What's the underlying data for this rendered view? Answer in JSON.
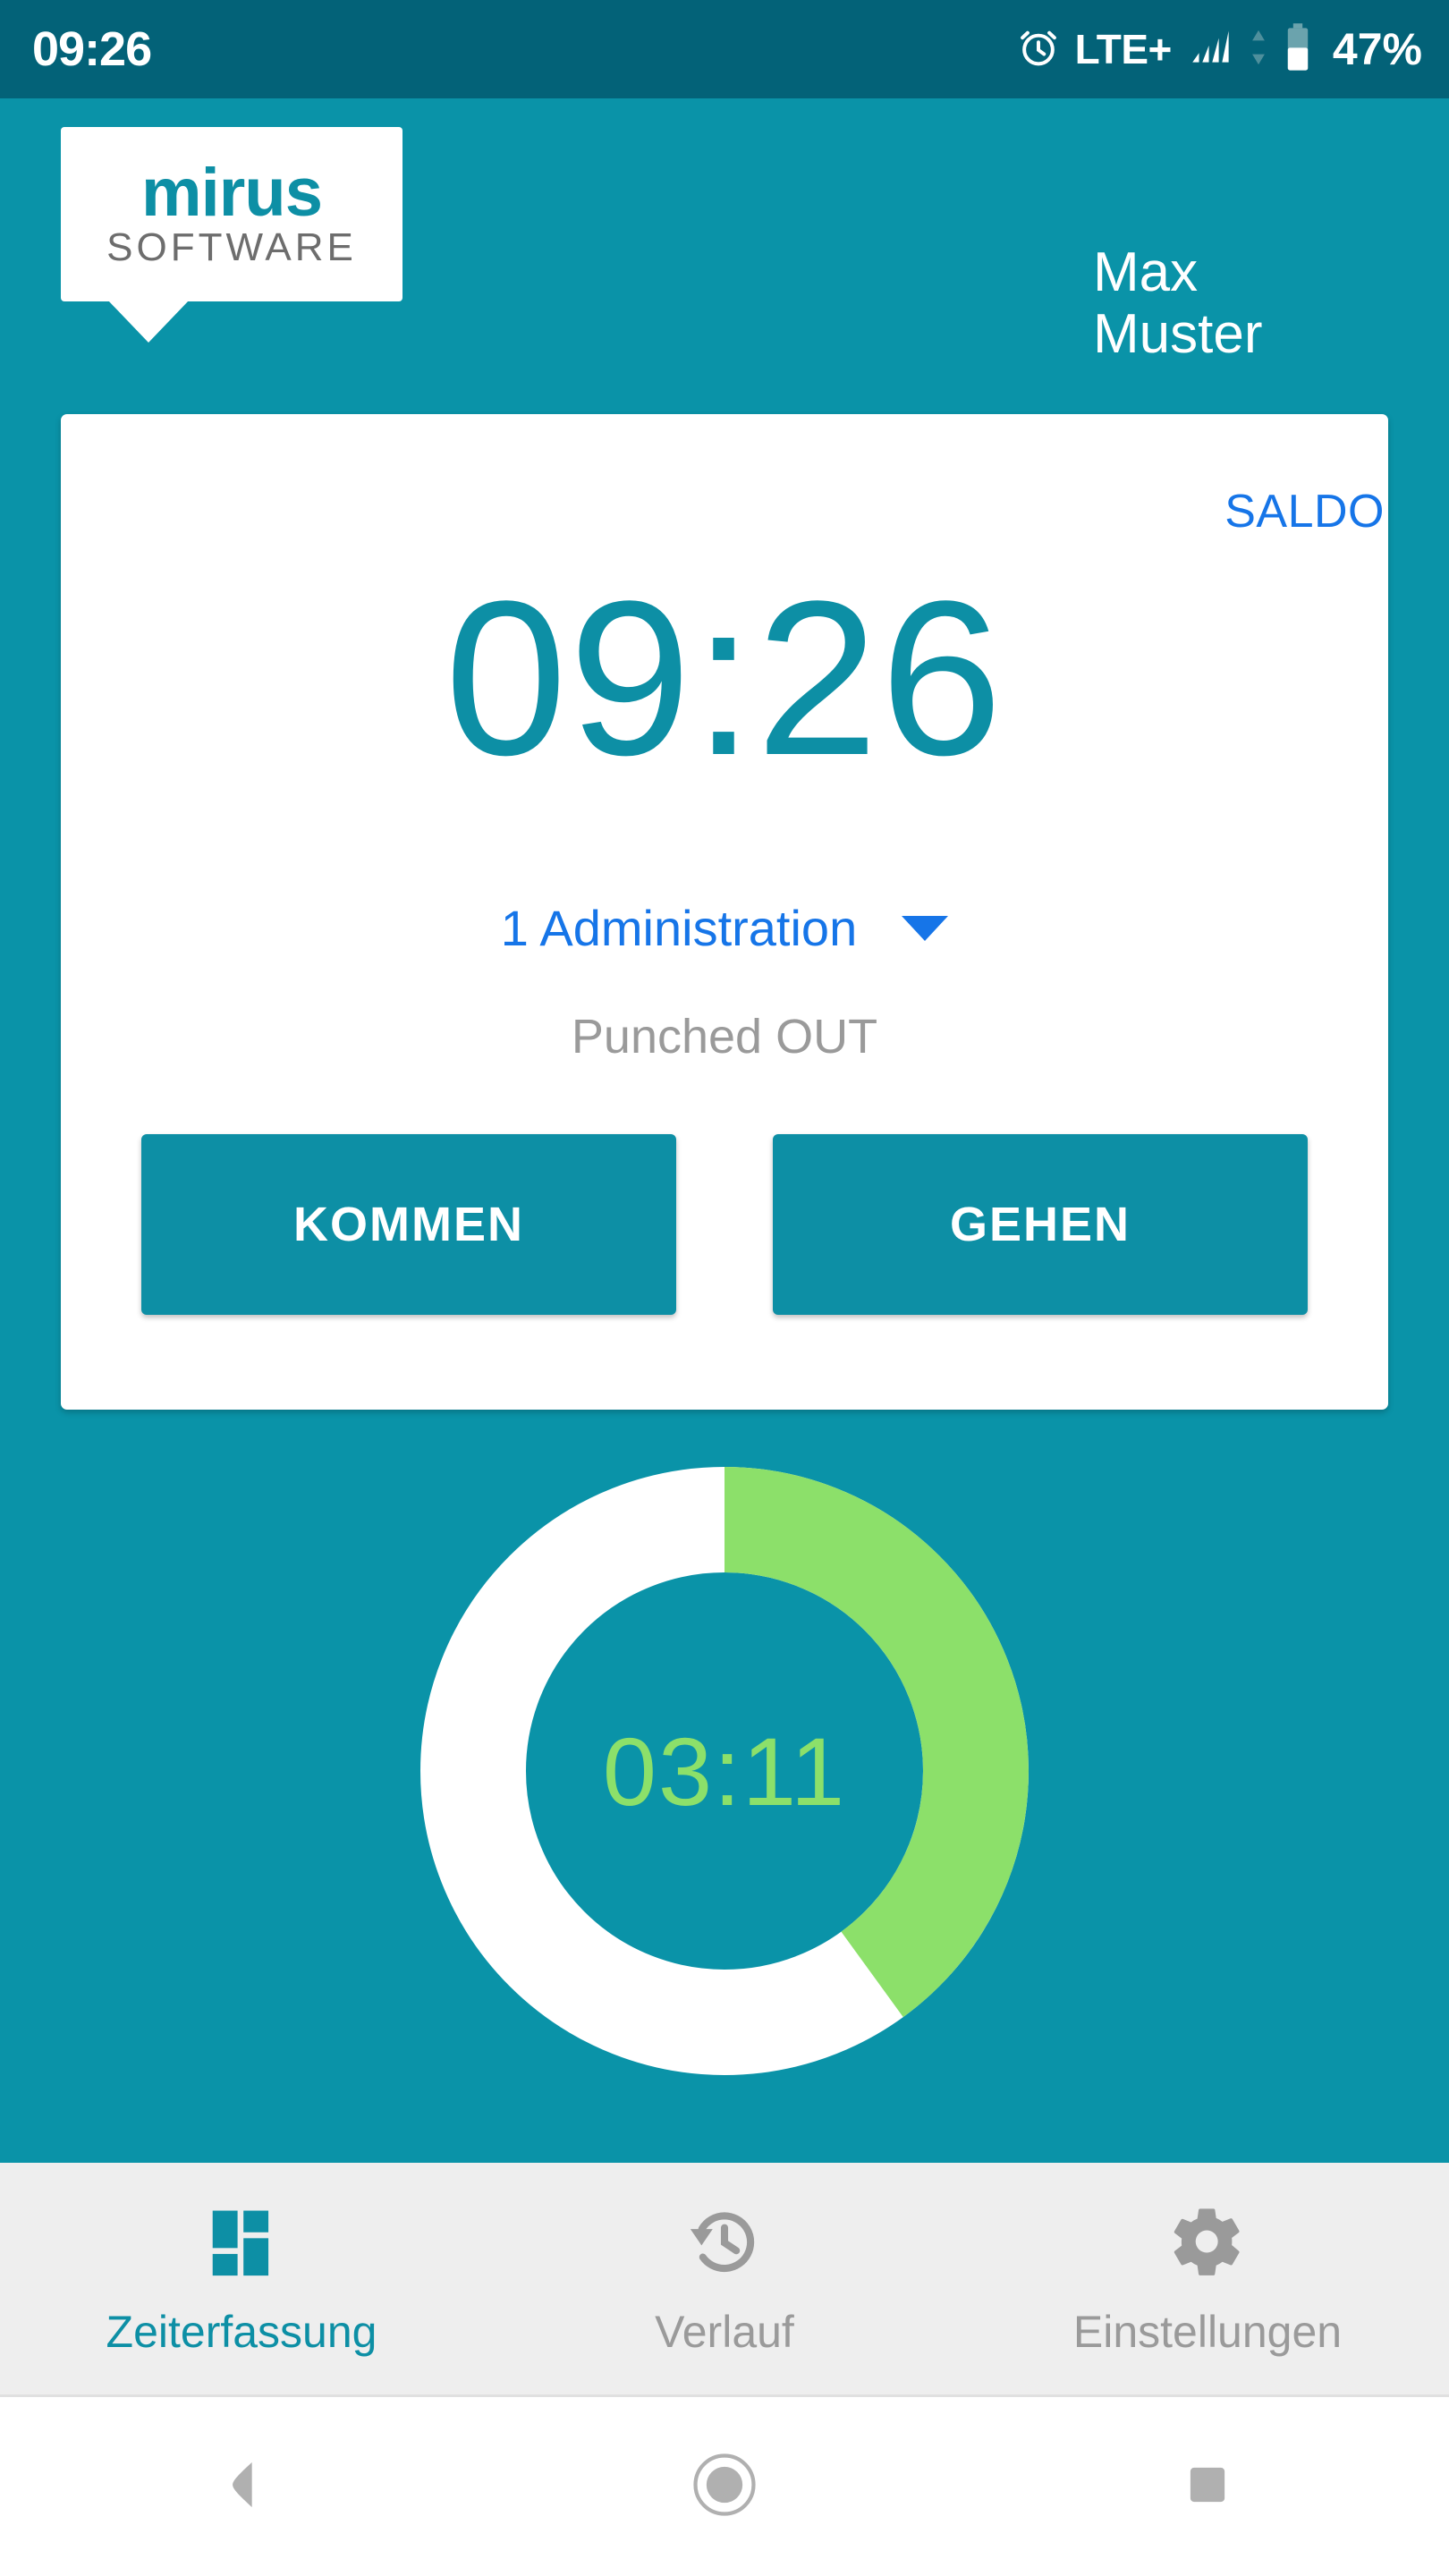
{
  "status_bar": {
    "clock": "09:26",
    "alarm_icon": "alarm-clock-icon",
    "network": "LTE+",
    "signal_icon": "signal-bars-icon",
    "data_arrows_icon": "data-transfer-arrows-icon",
    "battery_icon": "battery-icon",
    "battery_percent": "47%"
  },
  "header": {
    "logo_primary": "mirus",
    "logo_secondary": "SOFTWARE",
    "user_first_name": "Max",
    "user_last_name": "Muster"
  },
  "card": {
    "saldo_link": "SALDO",
    "current_time": "09:26",
    "department": "1 Administration",
    "dropdown_icon": "chevron-down-icon",
    "punch_status": "Punched OUT",
    "button_in": "KOMMEN",
    "button_out": "GEHEN"
  },
  "progress": {
    "elapsed": "03:11",
    "percent_complete": 40,
    "track_color": "#ffffff",
    "fill_color": "#8ce06a",
    "center_bg": "#0a93a8"
  },
  "bottom_nav": [
    {
      "label": "Zeiterfassung",
      "icon": "dashboard-grid-icon",
      "active": true
    },
    {
      "label": "Verlauf",
      "icon": "history-clock-icon",
      "active": false
    },
    {
      "label": "Einstellungen",
      "icon": "gear-icon",
      "active": false
    }
  ],
  "android_nav": {
    "back": "back-triangle-icon",
    "home": "home-circle-icon",
    "recents": "recents-square-icon"
  },
  "colors": {
    "brand_teal": "#0d8fa5",
    "background_teal": "#0a93a8",
    "statusbar_teal": "#036278",
    "link_blue": "#1675e8",
    "accent_green": "#8ce06a",
    "muted_gray": "#9a9a9a"
  }
}
